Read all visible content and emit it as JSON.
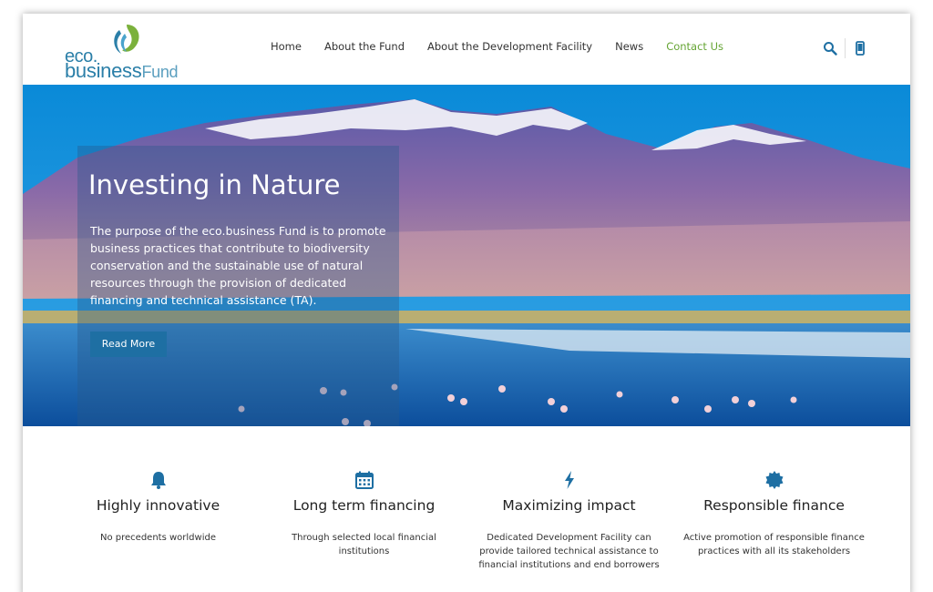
{
  "logo": {
    "eco": "eco.",
    "business": "business",
    "fund": "Fund"
  },
  "nav": {
    "items": [
      {
        "label": "Home"
      },
      {
        "label": "About the Fund"
      },
      {
        "label": "About the Development Facility"
      },
      {
        "label": "News"
      },
      {
        "label": "Contact Us",
        "active": true
      }
    ]
  },
  "header_icons": [
    "search-icon",
    "mobile-phone-icon"
  ],
  "hero": {
    "title": "Investing in Nature",
    "text": "The purpose of the eco.business Fund is to promote business practices that contribute to biodiversity conservation and the sustainable use of natural resources through the provision of dedicated financing and technical assistance (TA).",
    "button": "Read More"
  },
  "features": [
    {
      "icon": "bell-icon",
      "title": "Highly innovative",
      "text": "No precedents worldwide"
    },
    {
      "icon": "calendar-icon",
      "title": "Long term financing",
      "text": "Through selected local financial institutions"
    },
    {
      "icon": "lightning-bolt-icon",
      "title": "Maximizing impact",
      "text": "Dedicated Development Facility can provide tailored technical assistance to financial institutions and end borrowers"
    },
    {
      "icon": "gear-badge-icon",
      "title": "Responsible finance",
      "text": "Active promotion of responsible finance practices with all its stakeholders"
    }
  ],
  "colors": {
    "accent_blue": "#1e6fa3",
    "nav_active": "#66a534",
    "logo_blue": "#2b7fa8"
  }
}
